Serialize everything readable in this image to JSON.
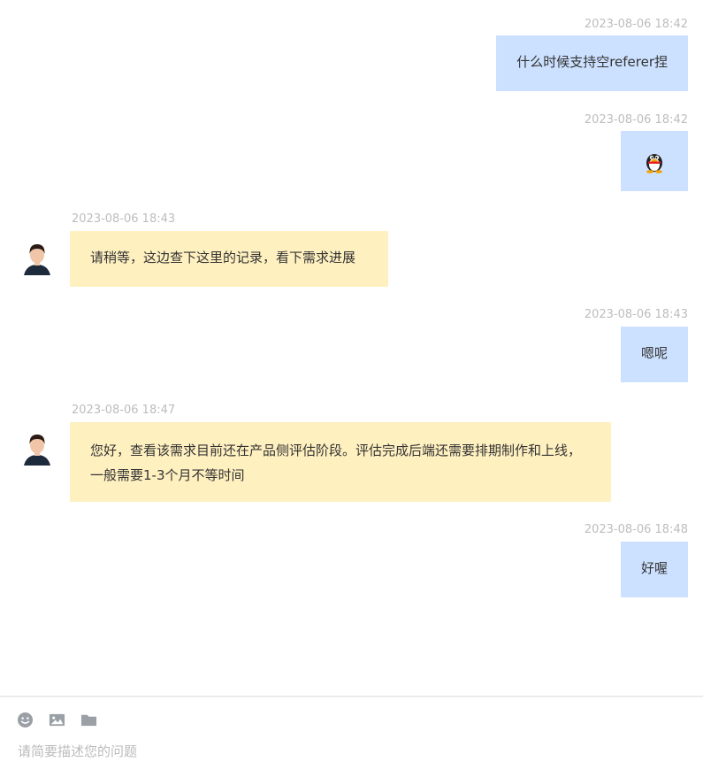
{
  "messages": [
    {
      "side": "right",
      "time": "2023-08-06 18:42",
      "text": "什么时候支持空referer捏"
    },
    {
      "side": "right",
      "time": "2023-08-06 18:42",
      "emoji": "penguin-emoji"
    },
    {
      "side": "left",
      "time": "2023-08-06 18:43",
      "text": "请稍等，这边查下这里的记录，看下需求进展"
    },
    {
      "side": "right",
      "time": "2023-08-06 18:43",
      "text": "嗯呢"
    },
    {
      "side": "left",
      "time": "2023-08-06 18:47",
      "text": "您好，查看该需求目前还在产品侧评估阶段。评估完成后端还需要排期制作和上线，一般需要1-3个月不等时间"
    },
    {
      "side": "right",
      "time": "2023-08-06 18:48",
      "text": "好喔"
    }
  ],
  "toolbar": {
    "icons": [
      "smiley-icon",
      "image-icon",
      "folder-icon"
    ]
  },
  "input": {
    "placeholder": "请简要描述您的问题"
  },
  "colors": {
    "user_bubble": "#cce1ff",
    "agent_bubble": "#fff0c0",
    "timestamp": "#bdbdbd",
    "icon": "#9aa0a6"
  }
}
